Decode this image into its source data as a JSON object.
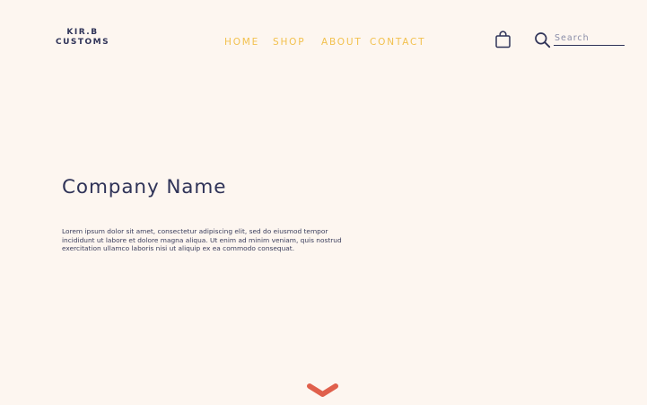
{
  "brand": {
    "line1": "KIR.B",
    "line2": "CUSTOMS"
  },
  "nav": {
    "items": [
      {
        "label": "HOME"
      },
      {
        "label": "SHOP"
      },
      {
        "label": "ABOUT"
      },
      {
        "label": "CONTACT"
      }
    ]
  },
  "header": {
    "cart_icon": "shopping-bag-icon",
    "search_icon": "magnifier-icon",
    "search_placeholder": "Search",
    "search_value": ""
  },
  "hero": {
    "title": "Company Name",
    "body_lines": [
      "Lorem ipsum dolor sit amet, consectetur adipiscing elit, sed do eiusmod tempor",
      "incididunt ut labore et dolore magna aliqua. Ut enim ad minim veniam, quis nostrud",
      "exercitation ullamco laboris nisi ut aliquip ex ea commodo consequat."
    ]
  },
  "scroll": {
    "icon": "chevron-down-icon"
  },
  "colors": {
    "background": "#fdf6f0",
    "text_dark": "#2f3358",
    "nav_accent": "#f2c14e",
    "chevron": "#e0604c"
  }
}
